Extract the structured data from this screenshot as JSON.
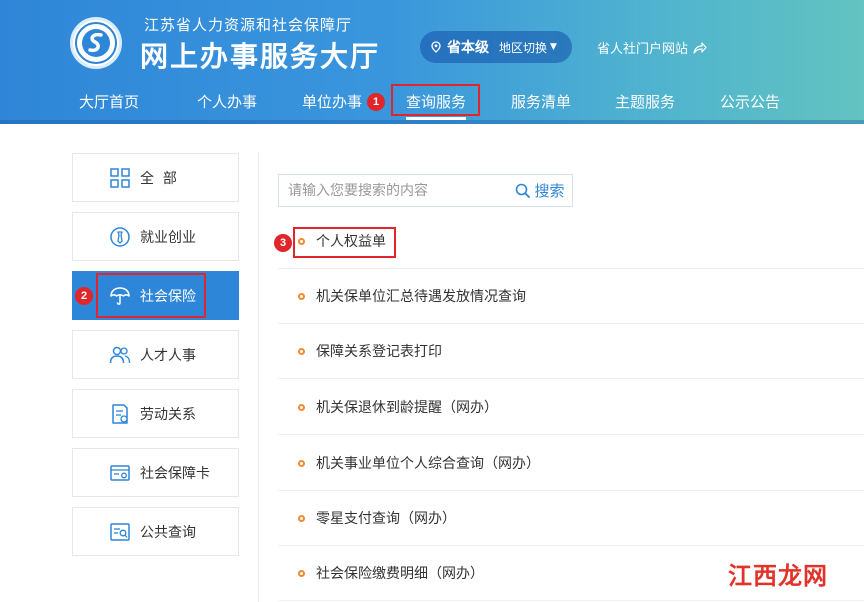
{
  "header": {
    "org_name": "江苏省人力资源和社会保障厅",
    "hall_name": "网上办事服务大厅",
    "level": "省本级",
    "region_switch": "地区切换",
    "portal_link": "省人社门户网站"
  },
  "nav": {
    "items": [
      {
        "label": "大厅首页"
      },
      {
        "label": "个人办事"
      },
      {
        "label": "单位办事"
      },
      {
        "label": "查询服务"
      },
      {
        "label": "服务清单"
      },
      {
        "label": "主题服务"
      },
      {
        "label": "公示公告"
      }
    ],
    "active_index": 3
  },
  "sidebar": {
    "items": [
      {
        "label": "全  部",
        "icon": "grid-icon"
      },
      {
        "label": "就业创业",
        "icon": "employment-icon"
      },
      {
        "label": "社会保险",
        "icon": "umbrella-icon"
      },
      {
        "label": "人才人事",
        "icon": "people-icon"
      },
      {
        "label": "劳动关系",
        "icon": "document-icon"
      },
      {
        "label": "社会保障卡",
        "icon": "card-icon"
      },
      {
        "label": "公共查询",
        "icon": "query-icon"
      }
    ],
    "active_index": 2
  },
  "search": {
    "placeholder": "请输入您要搜索的内容",
    "button_label": "搜索"
  },
  "results": {
    "items": [
      {
        "label": "个人权益单"
      },
      {
        "label": "机关保单位汇总待遇发放情况查询"
      },
      {
        "label": "保障关系登记表打印"
      },
      {
        "label": "机关保退休到龄提醒（网办）"
      },
      {
        "label": "机关事业单位个人综合查询（网办）"
      },
      {
        "label": "零星支付查询（网办）"
      },
      {
        "label": "社会保险缴费明细（网办）"
      }
    ]
  },
  "annotations": {
    "step1": "1",
    "step2": "2",
    "step3": "3"
  },
  "watermark": "江西龙网",
  "colors": {
    "primary": "#2e86d8",
    "header_start": "#2f86d8",
    "header_end": "#63c3c0",
    "highlight_red": "#e0262b",
    "bullet_orange": "#f08a34"
  }
}
